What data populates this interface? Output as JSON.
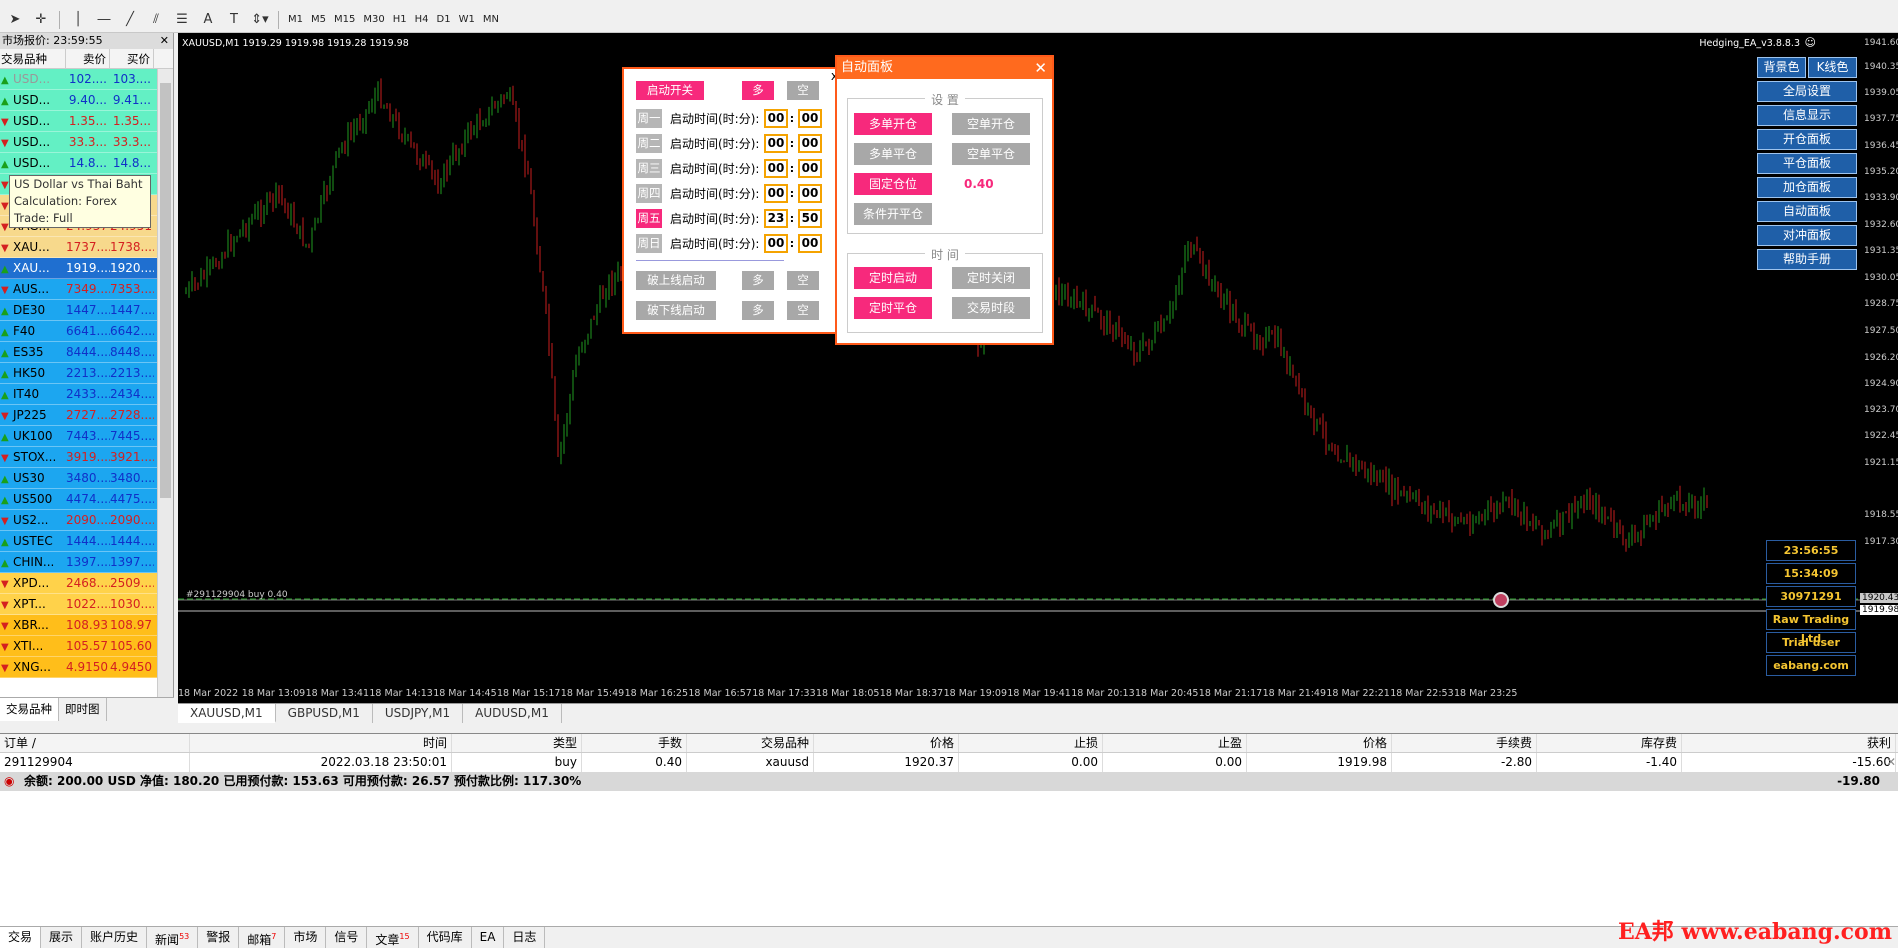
{
  "market_watch": {
    "title": "市场报价: 23:59:55",
    "col_symbol": "交易品种",
    "col_bid": "卖价",
    "col_ask": "买价",
    "rows": [
      {
        "sym": "USD...",
        "bid": "102....",
        "ask": "103....",
        "bg": "#63f0c4",
        "dim": true,
        "dir": "up"
      },
      {
        "sym": "USD...",
        "bid": "9.40...",
        "ask": "9.41...",
        "bg": "#63f0c4",
        "dir": "up"
      },
      {
        "sym": "USD...",
        "bid": "1.35...",
        "ask": "1.35...",
        "bg": "#63f0c4",
        "dir": "down"
      },
      {
        "sym": "USD...",
        "bid": "33.3...",
        "ask": "33.3...",
        "bg": "#63f0c4",
        "dir": "down"
      },
      {
        "sym": "USD...",
        "bid": "14.8...",
        "ask": "14.8...",
        "bg": "#63f0c4",
        "dir": "up"
      },
      {
        "sym": "",
        "bid": "",
        "ask": "",
        "bg": "#63f0c4",
        "dir": "down"
      },
      {
        "sym": "",
        "bid": "",
        "ask": "",
        "bg": "#f7d98c",
        "dir": "down"
      },
      {
        "sym": "XAG...",
        "bid": "24.937",
        "ask": "24.951",
        "bg": "#f7d98c",
        "dir": "down"
      },
      {
        "sym": "XAU...",
        "bid": "1737....",
        "ask": "1738....",
        "bg": "#f7d98c",
        "dir": "down"
      },
      {
        "sym": "XAU...",
        "bid": "1919....",
        "ask": "1920....",
        "bg": "#1f6fd0",
        "sel": true,
        "dir": "up"
      },
      {
        "sym": "AUS...",
        "bid": "7349....",
        "ask": "7353....",
        "bg": "#1ca6f0",
        "dir": "down"
      },
      {
        "sym": "DE30",
        "bid": "1447....",
        "ask": "1447....",
        "bg": "#1ca6f0",
        "dir": "up"
      },
      {
        "sym": "F40",
        "bid": "6641....",
        "ask": "6642....",
        "bg": "#1ca6f0",
        "dir": "up"
      },
      {
        "sym": "ES35",
        "bid": "8444....",
        "ask": "8448....",
        "bg": "#1ca6f0",
        "dir": "up"
      },
      {
        "sym": "HK50",
        "bid": "2213....",
        "ask": "2213....",
        "bg": "#1ca6f0",
        "dir": "up"
      },
      {
        "sym": "IT40",
        "bid": "2433....",
        "ask": "2434....",
        "bg": "#1ca6f0",
        "dir": "up"
      },
      {
        "sym": "JP225",
        "bid": "2727....",
        "ask": "2728....",
        "bg": "#1ca6f0",
        "dir": "down"
      },
      {
        "sym": "UK100",
        "bid": "7443....",
        "ask": "7445....",
        "bg": "#1ca6f0",
        "dir": "up"
      },
      {
        "sym": "STOX...",
        "bid": "3919....",
        "ask": "3921....",
        "bg": "#1ca6f0",
        "dir": "down"
      },
      {
        "sym": "US30",
        "bid": "3480....",
        "ask": "3480....",
        "bg": "#1ca6f0",
        "dir": "up"
      },
      {
        "sym": "US500",
        "bid": "4474....",
        "ask": "4475....",
        "bg": "#1ca6f0",
        "dir": "up"
      },
      {
        "sym": "US2...",
        "bid": "2090....",
        "ask": "2090....",
        "bg": "#1ca6f0",
        "dir": "down"
      },
      {
        "sym": "USTEC",
        "bid": "1444....",
        "ask": "1444....",
        "bg": "#1ca6f0",
        "dir": "up"
      },
      {
        "sym": "CHIN...",
        "bid": "1397....",
        "ask": "1397....",
        "bg": "#1ca6f0",
        "dir": "up"
      },
      {
        "sym": "XPD...",
        "bid": "2468....",
        "ask": "2509....",
        "bg": "#ffd24a",
        "dir": "down"
      },
      {
        "sym": "XPT...",
        "bid": "1022....",
        "ask": "1030....",
        "bg": "#ffd24a",
        "dir": "down"
      },
      {
        "sym": "XBR...",
        "bid": "108.93",
        "ask": "108.97",
        "bg": "#ffbe1a",
        "dir": "down"
      },
      {
        "sym": "XTI...",
        "bid": "105.57",
        "ask": "105.60",
        "bg": "#ffbe1a",
        "dir": "down"
      },
      {
        "sym": "XNG...",
        "bid": "4.9150",
        "ask": "4.9450",
        "bg": "#ffbe1a",
        "dir": "down"
      }
    ],
    "tab_symbols": "交易品种",
    "tab_tick": "即时图"
  },
  "tooltip": {
    "line1": "US Dollar vs Thai Baht",
    "line2": "Calculation: Forex",
    "line3": "Trade: Full"
  },
  "toolbar": {
    "timeframes": [
      "M1",
      "M5",
      "M15",
      "M30",
      "H1",
      "H4",
      "D1",
      "W1",
      "MN"
    ]
  },
  "chart": {
    "info": "XAUUSD,M1  1919.29 1919.98 1919.28 1919.98",
    "ea": "Hedging_EA_v3.8.8.3",
    "order_label": "#291129904 buy 0.40",
    "y_labels": [
      "1941.60",
      "1940.35",
      "1939.05",
      "1937.75",
      "1936.45",
      "1935.20",
      "1933.90",
      "1932.60",
      "1931.35",
      "1930.05",
      "1928.75",
      "1927.50",
      "1926.20",
      "1924.90",
      "1923.70",
      "1922.45",
      "1921.15",
      "1918.55",
      "1917.30"
    ],
    "price_tag_1": "1920.43",
    "price_tag_2": "1919.98",
    "x_labels": [
      "18 Mar 2022",
      "18 Mar 13:09",
      "18 Mar 13:41",
      "18 Mar 14:13",
      "18 Mar 14:45",
      "18 Mar 15:17",
      "18 Mar 15:49",
      "18 Mar 16:25",
      "18 Mar 16:57",
      "18 Mar 17:33",
      "18 Mar 18:05",
      "18 Mar 18:37",
      "18 Mar 19:09",
      "18 Mar 19:41",
      "18 Mar 20:13",
      "18 Mar 20:45",
      "18 Mar 21:17",
      "18 Mar 21:49",
      "18 Mar 22:21",
      "18 Mar 22:53",
      "18 Mar 23:25"
    ]
  },
  "chart_tabs": [
    "XAUUSD,M1",
    "GBPUSD,M1",
    "USDJPY,M1",
    "AUDUSD,M1"
  ],
  "right_panel": {
    "bg_color": "背景色",
    "kline": "K线色",
    "buttons": [
      "全局设置",
      "信息显示",
      "开仓面板",
      "平仓面板",
      "加仓面板",
      "自动面板",
      "对冲面板",
      "帮助手册"
    ]
  },
  "info_panel": [
    "23:56:55",
    "15:34:09",
    "30971291",
    "Raw Trading Ltd",
    "Trial user",
    "eabang.com"
  ],
  "schedule_panel": {
    "close": "x",
    "start_switch": "启动开关",
    "long": "多",
    "short": "空",
    "time_label": "启动时间(时:分):",
    "days": [
      {
        "day": "周一",
        "h": "00",
        "m": "00",
        "on": false
      },
      {
        "day": "周二",
        "h": "00",
        "m": "00",
        "on": false
      },
      {
        "day": "周三",
        "h": "00",
        "m": "00",
        "on": false
      },
      {
        "day": "周四",
        "h": "00",
        "m": "00",
        "on": false
      },
      {
        "day": "周五",
        "h": "23",
        "m": "50",
        "on": true
      },
      {
        "day": "周日",
        "h": "00",
        "m": "00",
        "on": false
      }
    ],
    "break_up": "破上线启动",
    "break_down": "破下线启动"
  },
  "auto_panel": {
    "title": "自动面板",
    "close": "✕",
    "settings": "设 置",
    "time": "时 间",
    "buy_open": "多单开仓",
    "sell_open": "空单开仓",
    "buy_close": "多单平仓",
    "sell_close": "空单平仓",
    "fixed_lot": "固定仓位",
    "lot_value": "0.40",
    "cond_open_close": "条件开平仓",
    "timed_start": "定时启动",
    "timed_stop": "定时关闭",
    "timed_close": "定时平仓",
    "trade_period": "交易时段"
  },
  "terminal": {
    "headers": [
      "订单 /",
      "时间",
      "类型",
      "手数",
      "交易品种",
      "价格",
      "止损",
      "止盈",
      "价格",
      "手续费",
      "库存费",
      "获利"
    ],
    "row": [
      "291129904",
      "2022.03.18 23:50:01",
      "buy",
      "0.40",
      "xauusd",
      "1920.37",
      "0.00",
      "0.00",
      "1919.98",
      "-2.80",
      "-1.40",
      "-15.60"
    ],
    "balance": "余额: 200.00 USD  净值: 180.20  已用预付款: 153.63  可用预付款: 26.57  预付款比例: 117.30%",
    "total": "-19.80"
  },
  "bottom_tabs": [
    {
      "label": "交易",
      "badge": ""
    },
    {
      "label": "展示",
      "badge": ""
    },
    {
      "label": "账户历史",
      "badge": ""
    },
    {
      "label": "新闻",
      "badge": "53"
    },
    {
      "label": "警报",
      "badge": ""
    },
    {
      "label": "邮箱",
      "badge": "7"
    },
    {
      "label": "市场",
      "badge": ""
    },
    {
      "label": "信号",
      "badge": ""
    },
    {
      "label": "文章",
      "badge": "15"
    },
    {
      "label": "代码库",
      "badge": ""
    },
    {
      "label": "EA",
      "badge": ""
    },
    {
      "label": "日志",
      "badge": ""
    }
  ],
  "watermark": "EA邦 www.eabang.com"
}
